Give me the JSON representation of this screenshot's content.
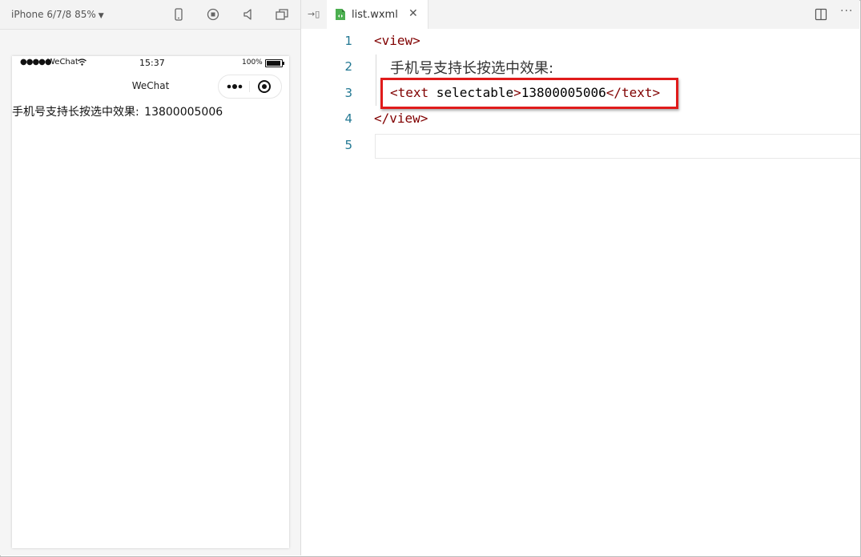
{
  "simulator": {
    "device_label": "iPhone 6/7/8 85%",
    "status_bar": {
      "signal": "●●●●●",
      "carrier": "WeChat",
      "time": "15:37",
      "battery_pct": "100%"
    },
    "nav_title": "WeChat",
    "content_label": "手机号支持长按选中效果:",
    "content_number": "13800005006"
  },
  "editor": {
    "tab_label": "list.wxml",
    "lines": [
      {
        "num": "1",
        "open": "<view>"
      },
      {
        "num": "2",
        "text": "手机号支持长按选中效果:"
      },
      {
        "num": "3",
        "tag_open": "<text",
        "attr": " selectable",
        "tag_gt": ">",
        "value": "13800005006",
        "tag_close": "</text>"
      },
      {
        "num": "4",
        "close": "</view>"
      },
      {
        "num": "5"
      }
    ],
    "highlight_color": "#e01b1b"
  },
  "colors": {
    "tag": "#800000",
    "line_number": "#237893",
    "tab_icon": "#4caf50"
  }
}
